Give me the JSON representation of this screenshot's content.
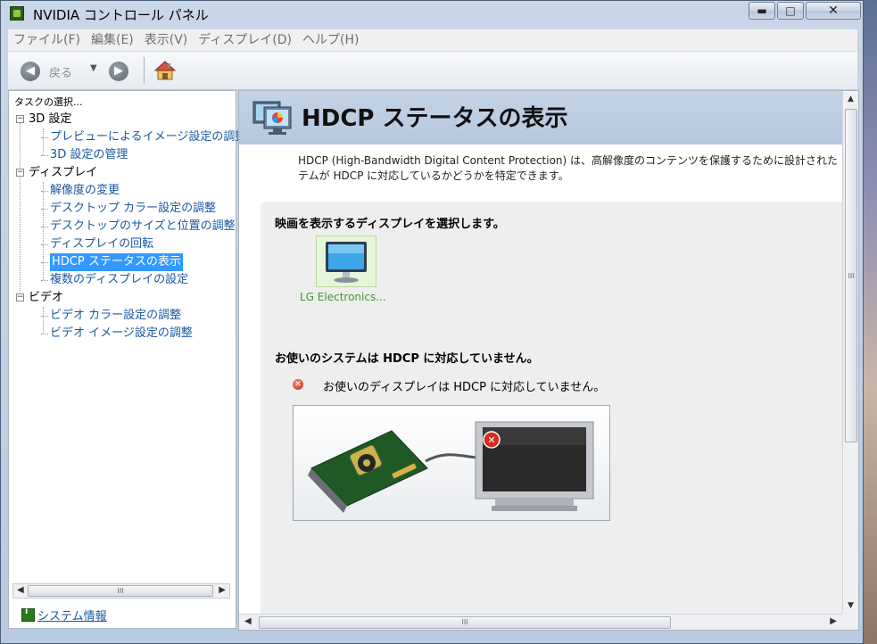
{
  "window": {
    "title": "NVIDIA コントロール パネル",
    "min_glyph": "▬",
    "max_glyph": "□",
    "close_glyph": "✕"
  },
  "menubar": {
    "items": [
      "ファイル(F)",
      "編集(E)",
      "表示(V)",
      "ディスプレイ(D)",
      "ヘルプ(H)"
    ]
  },
  "toolbar": {
    "back_label": "戻る",
    "back_icon": "back-arrow-icon",
    "forward_icon": "forward-arrow-icon",
    "home_icon": "home-icon",
    "dropdown_glyph": "▼"
  },
  "sidebar": {
    "header": "タスクの選択...",
    "categories": [
      {
        "label": "3D 設定",
        "toggle": "−",
        "items": [
          "プレビューによるイメージ設定の調整",
          "3D 設定の管理"
        ]
      },
      {
        "label": "ディスプレイ",
        "toggle": "−",
        "items": [
          "解像度の変更",
          "デスクトップ カラー設定の調整",
          "デスクトップのサイズと位置の調整",
          "ディスプレイの回転",
          "HDCP ステータスの表示",
          "複数のディスプレイの設定"
        ]
      },
      {
        "label": "ビデオ",
        "toggle": "−",
        "items": [
          "ビデオ カラー設定の調整",
          "ビデオ イメージ設定の調整"
        ]
      }
    ],
    "selected_item": "HDCP ステータスの表示",
    "system_info": "システム情報"
  },
  "main": {
    "title": "HDCP ステータスの表示",
    "description_line1": "HDCP (High-Bandwidth Digital Content Protection) は、高解像度のコンテンツを保護するために設計された",
    "description_line2": "テムが HDCP に対応しているかどうかを特定できます。",
    "select_heading": "映画を表示するディスプレイを選択します。",
    "display_name": "LG Electronics...",
    "status_heading": "お使いのシステムは HDCP に対応していません。",
    "error_message": "お使いのディスプレイは HDCP に対応していません。",
    "error_glyph": "✕"
  },
  "scrollbar": {
    "grip": "III",
    "up": "▲",
    "down": "▼",
    "left": "◀",
    "right": "▶"
  },
  "colors": {
    "link": "#1a58a5",
    "selected": "#3399ff",
    "display_label": "#3c9a2a",
    "banner": "#c4d4e6"
  }
}
